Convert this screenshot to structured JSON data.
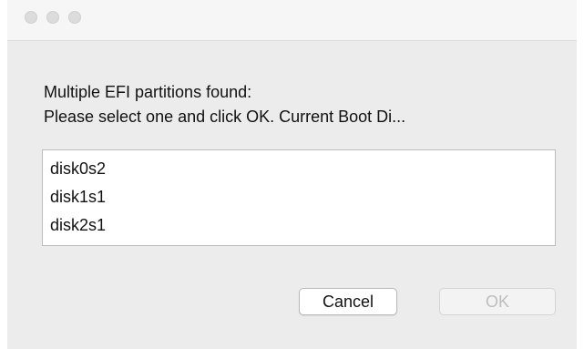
{
  "dialog": {
    "message_line1": "Multiple EFI partitions found:",
    "message_line2": "Please select one and click OK. Current Boot Di...",
    "partitions": [
      "disk0s2",
      "disk1s1",
      "disk2s1"
    ],
    "cancel_label": "Cancel",
    "ok_label": "OK",
    "ok_enabled": false
  }
}
